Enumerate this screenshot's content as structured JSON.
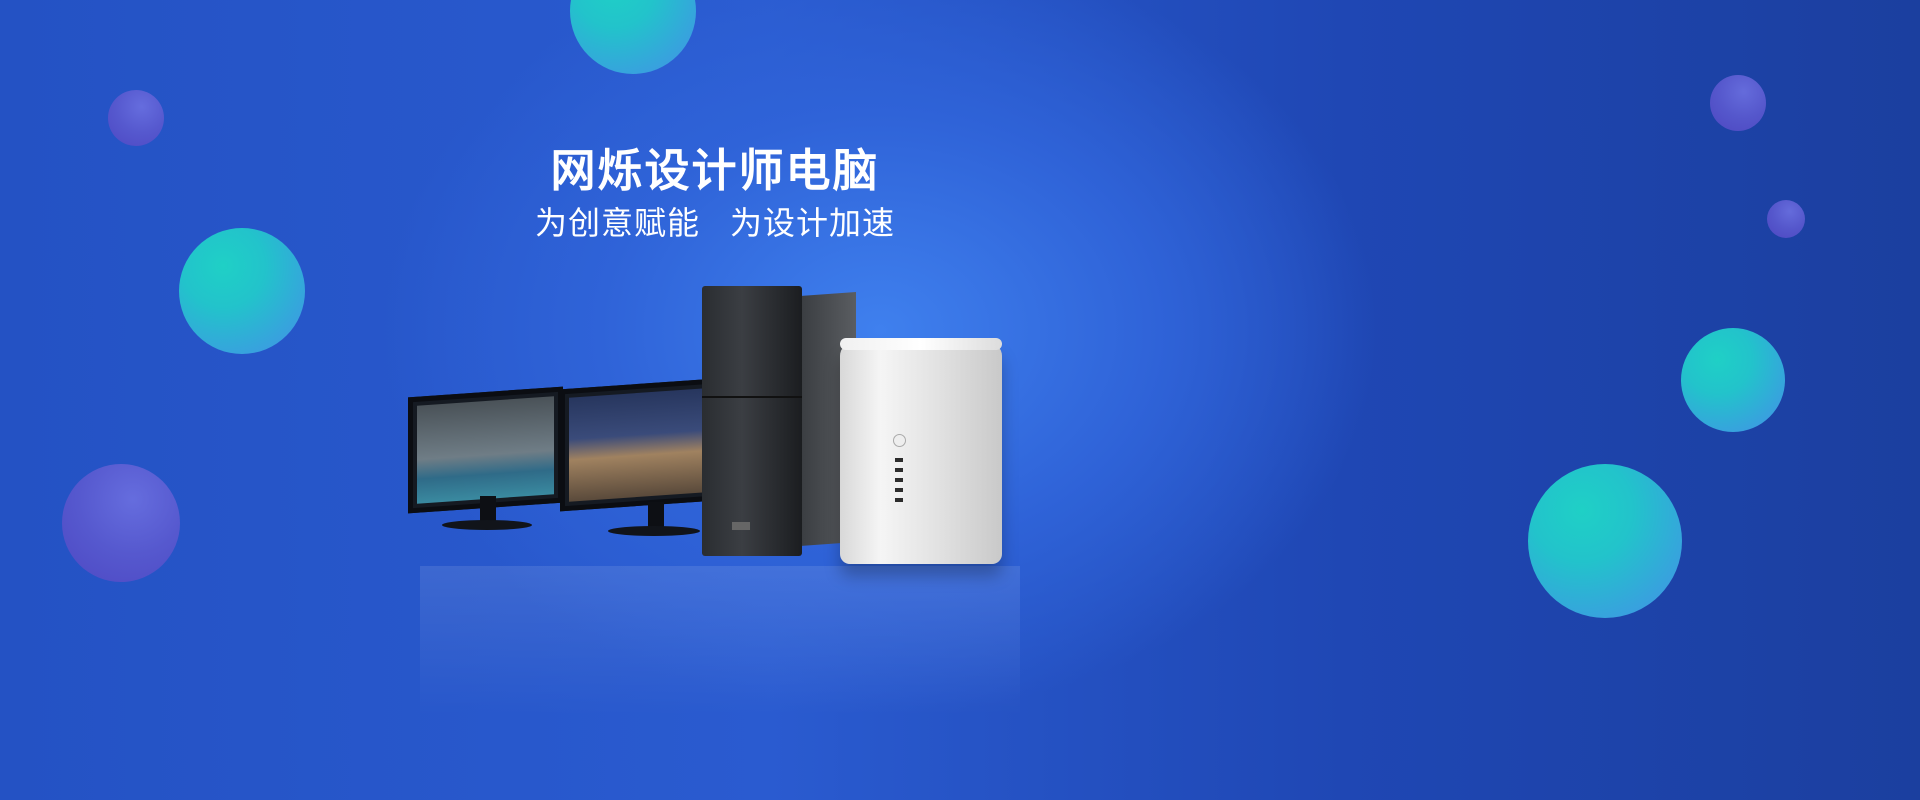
{
  "hero": {
    "title": "网烁设计师电脑",
    "subtitle_part1": "为创意赋能",
    "subtitle_part2": "为设计加速"
  },
  "colors": {
    "background_dark": "#1b3f9f",
    "background_light": "#3f80ee",
    "bubble_teal": "#1fd0c6",
    "bubble_violet": "#5a59cf",
    "text": "#ffffff"
  }
}
